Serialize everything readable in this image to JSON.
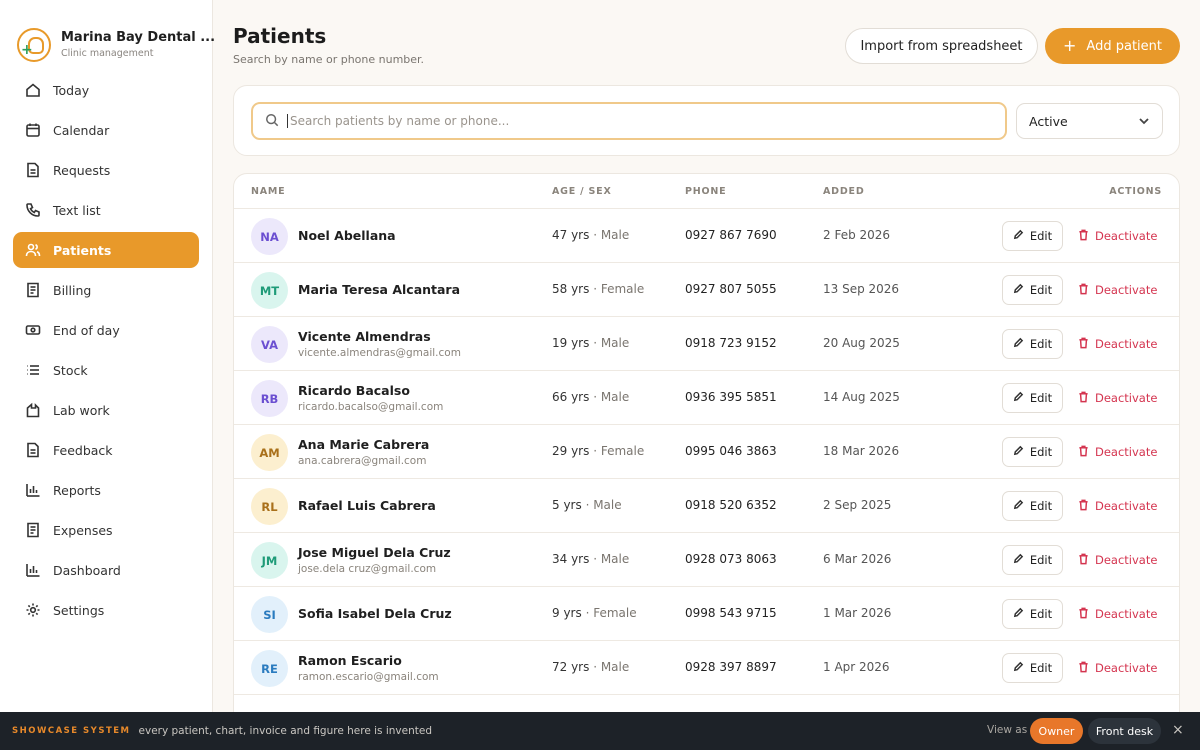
{
  "brand": {
    "name": "Marina Bay Dental ...",
    "subtitle": "Clinic management"
  },
  "nav": [
    {
      "label": "Today",
      "icon": "home-icon",
      "active": false
    },
    {
      "label": "Calendar",
      "icon": "calendar-icon",
      "active": false
    },
    {
      "label": "Requests",
      "icon": "document-icon",
      "active": false
    },
    {
      "label": "Text list",
      "icon": "phone-icon",
      "active": false
    },
    {
      "label": "Patients",
      "icon": "users-icon",
      "active": true
    },
    {
      "label": "Billing",
      "icon": "receipt-icon",
      "active": false
    },
    {
      "label": "End of day",
      "icon": "cash-icon",
      "active": false
    },
    {
      "label": "Stock",
      "icon": "list-icon",
      "active": false
    },
    {
      "label": "Lab work",
      "icon": "flask-icon",
      "active": false
    },
    {
      "label": "Feedback",
      "icon": "document-icon",
      "active": false
    },
    {
      "label": "Reports",
      "icon": "bar-chart-icon",
      "active": false
    },
    {
      "label": "Expenses",
      "icon": "receipt-icon",
      "active": false
    },
    {
      "label": "Dashboard",
      "icon": "bar-chart-icon",
      "active": false
    },
    {
      "label": "Settings",
      "icon": "gear-icon",
      "active": false
    }
  ],
  "header": {
    "title": "Patients",
    "subtitle": "Search by name or phone number.",
    "import_label": "Import from spreadsheet",
    "add_label": "Add patient"
  },
  "search": {
    "placeholder": "Search patients by name or phone...",
    "value": ""
  },
  "filter": {
    "selected": "Active"
  },
  "table": {
    "headers": {
      "name": "NAME",
      "age_sex": "AGE / SEX",
      "phone": "PHONE",
      "added": "ADDED",
      "actions": "ACTIONS"
    },
    "edit_label": "Edit",
    "deactivate_label": "Deactivate",
    "rows": [
      {
        "initials": "NA",
        "name": "Noel Abellana",
        "email": "",
        "age": "47 yrs",
        "sex": "Male",
        "phone": "0927 867 7690",
        "added": "2 Feb 2026",
        "avatar_bg": "#ece8fb",
        "avatar_fg": "#6b4fd1"
      },
      {
        "initials": "MT",
        "name": "Maria Teresa Alcantara",
        "email": "",
        "age": "58 yrs",
        "sex": "Female",
        "phone": "0927 807 5055",
        "added": "13 Sep 2026",
        "avatar_bg": "#d9f5ee",
        "avatar_fg": "#1e9b78"
      },
      {
        "initials": "VA",
        "name": "Vicente Almendras",
        "email": "vicente.almendras@gmail.com",
        "age": "19 yrs",
        "sex": "Male",
        "phone": "0918 723 9152",
        "added": "20 Aug 2025",
        "avatar_bg": "#ece8fb",
        "avatar_fg": "#6b4fd1"
      },
      {
        "initials": "RB",
        "name": "Ricardo Bacalso",
        "email": "ricardo.bacalso@gmail.com",
        "age": "66 yrs",
        "sex": "Male",
        "phone": "0936 395 5851",
        "added": "14 Aug 2025",
        "avatar_bg": "#ece8fb",
        "avatar_fg": "#6b4fd1"
      },
      {
        "initials": "AM",
        "name": "Ana Marie Cabrera",
        "email": "ana.cabrera@gmail.com",
        "age": "29 yrs",
        "sex": "Female",
        "phone": "0995 046 3863",
        "added": "18 Mar 2026",
        "avatar_bg": "#fcefcf",
        "avatar_fg": "#a9701a"
      },
      {
        "initials": "RL",
        "name": "Rafael Luis Cabrera",
        "email": "",
        "age": "5 yrs",
        "sex": "Male",
        "phone": "0918 520 6352",
        "added": "2 Sep 2025",
        "avatar_bg": "#fcefcf",
        "avatar_fg": "#a9701a"
      },
      {
        "initials": "JM",
        "name": "Jose Miguel Dela Cruz",
        "email": "jose.dela cruz@gmail.com",
        "age": "34 yrs",
        "sex": "Male",
        "phone": "0928 073 8063",
        "added": "6 Mar 2026",
        "avatar_bg": "#d9f5ee",
        "avatar_fg": "#1e9b78"
      },
      {
        "initials": "SI",
        "name": "Sofia Isabel Dela Cruz",
        "email": "",
        "age": "9 yrs",
        "sex": "Female",
        "phone": "0998 543 9715",
        "added": "1 Mar 2026",
        "avatar_bg": "#e2f0fb",
        "avatar_fg": "#2a7bbf"
      },
      {
        "initials": "RE",
        "name": "Ramon Escario",
        "email": "ramon.escario@gmail.com",
        "age": "72 yrs",
        "sex": "Male",
        "phone": "0928 397 8897",
        "added": "1 Apr 2026",
        "avatar_bg": "#e2f0fb",
        "avatar_fg": "#2a7bbf"
      }
    ]
  },
  "footer": {
    "brand": "SHOWCASE SYSTEM",
    "note": "every patient, chart, invoice and figure here is invented",
    "view_as": "View as",
    "owner": "Owner",
    "front_desk": "Front desk",
    "close": "×"
  },
  "colors": {
    "accent": "#e8992a",
    "danger": "#d4344f",
    "footer_bg": "#1d2228"
  }
}
